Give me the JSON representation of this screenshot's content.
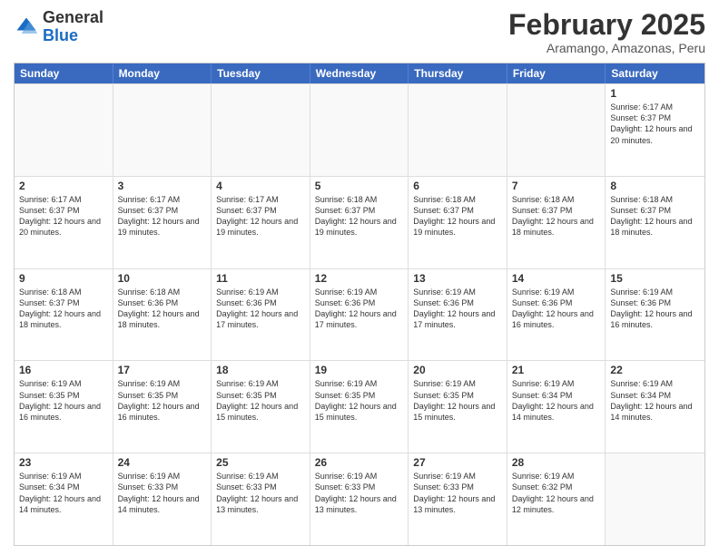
{
  "logo": {
    "general": "General",
    "blue": "Blue"
  },
  "header": {
    "title": "February 2025",
    "subtitle": "Aramango, Amazonas, Peru"
  },
  "days": [
    "Sunday",
    "Monday",
    "Tuesday",
    "Wednesday",
    "Thursday",
    "Friday",
    "Saturday"
  ],
  "weeks": [
    [
      {
        "day": "",
        "info": ""
      },
      {
        "day": "",
        "info": ""
      },
      {
        "day": "",
        "info": ""
      },
      {
        "day": "",
        "info": ""
      },
      {
        "day": "",
        "info": ""
      },
      {
        "day": "",
        "info": ""
      },
      {
        "day": "1",
        "info": "Sunrise: 6:17 AM\nSunset: 6:37 PM\nDaylight: 12 hours and 20 minutes."
      }
    ],
    [
      {
        "day": "2",
        "info": "Sunrise: 6:17 AM\nSunset: 6:37 PM\nDaylight: 12 hours and 20 minutes."
      },
      {
        "day": "3",
        "info": "Sunrise: 6:17 AM\nSunset: 6:37 PM\nDaylight: 12 hours and 19 minutes."
      },
      {
        "day": "4",
        "info": "Sunrise: 6:17 AM\nSunset: 6:37 PM\nDaylight: 12 hours and 19 minutes."
      },
      {
        "day": "5",
        "info": "Sunrise: 6:18 AM\nSunset: 6:37 PM\nDaylight: 12 hours and 19 minutes."
      },
      {
        "day": "6",
        "info": "Sunrise: 6:18 AM\nSunset: 6:37 PM\nDaylight: 12 hours and 19 minutes."
      },
      {
        "day": "7",
        "info": "Sunrise: 6:18 AM\nSunset: 6:37 PM\nDaylight: 12 hours and 18 minutes."
      },
      {
        "day": "8",
        "info": "Sunrise: 6:18 AM\nSunset: 6:37 PM\nDaylight: 12 hours and 18 minutes."
      }
    ],
    [
      {
        "day": "9",
        "info": "Sunrise: 6:18 AM\nSunset: 6:37 PM\nDaylight: 12 hours and 18 minutes."
      },
      {
        "day": "10",
        "info": "Sunrise: 6:18 AM\nSunset: 6:36 PM\nDaylight: 12 hours and 18 minutes."
      },
      {
        "day": "11",
        "info": "Sunrise: 6:19 AM\nSunset: 6:36 PM\nDaylight: 12 hours and 17 minutes."
      },
      {
        "day": "12",
        "info": "Sunrise: 6:19 AM\nSunset: 6:36 PM\nDaylight: 12 hours and 17 minutes."
      },
      {
        "day": "13",
        "info": "Sunrise: 6:19 AM\nSunset: 6:36 PM\nDaylight: 12 hours and 17 minutes."
      },
      {
        "day": "14",
        "info": "Sunrise: 6:19 AM\nSunset: 6:36 PM\nDaylight: 12 hours and 16 minutes."
      },
      {
        "day": "15",
        "info": "Sunrise: 6:19 AM\nSunset: 6:36 PM\nDaylight: 12 hours and 16 minutes."
      }
    ],
    [
      {
        "day": "16",
        "info": "Sunrise: 6:19 AM\nSunset: 6:35 PM\nDaylight: 12 hours and 16 minutes."
      },
      {
        "day": "17",
        "info": "Sunrise: 6:19 AM\nSunset: 6:35 PM\nDaylight: 12 hours and 16 minutes."
      },
      {
        "day": "18",
        "info": "Sunrise: 6:19 AM\nSunset: 6:35 PM\nDaylight: 12 hours and 15 minutes."
      },
      {
        "day": "19",
        "info": "Sunrise: 6:19 AM\nSunset: 6:35 PM\nDaylight: 12 hours and 15 minutes."
      },
      {
        "day": "20",
        "info": "Sunrise: 6:19 AM\nSunset: 6:35 PM\nDaylight: 12 hours and 15 minutes."
      },
      {
        "day": "21",
        "info": "Sunrise: 6:19 AM\nSunset: 6:34 PM\nDaylight: 12 hours and 14 minutes."
      },
      {
        "day": "22",
        "info": "Sunrise: 6:19 AM\nSunset: 6:34 PM\nDaylight: 12 hours and 14 minutes."
      }
    ],
    [
      {
        "day": "23",
        "info": "Sunrise: 6:19 AM\nSunset: 6:34 PM\nDaylight: 12 hours and 14 minutes."
      },
      {
        "day": "24",
        "info": "Sunrise: 6:19 AM\nSunset: 6:33 PM\nDaylight: 12 hours and 14 minutes."
      },
      {
        "day": "25",
        "info": "Sunrise: 6:19 AM\nSunset: 6:33 PM\nDaylight: 12 hours and 13 minutes."
      },
      {
        "day": "26",
        "info": "Sunrise: 6:19 AM\nSunset: 6:33 PM\nDaylight: 12 hours and 13 minutes."
      },
      {
        "day": "27",
        "info": "Sunrise: 6:19 AM\nSunset: 6:33 PM\nDaylight: 12 hours and 13 minutes."
      },
      {
        "day": "28",
        "info": "Sunrise: 6:19 AM\nSunset: 6:32 PM\nDaylight: 12 hours and 12 minutes."
      },
      {
        "day": "",
        "info": ""
      }
    ]
  ]
}
